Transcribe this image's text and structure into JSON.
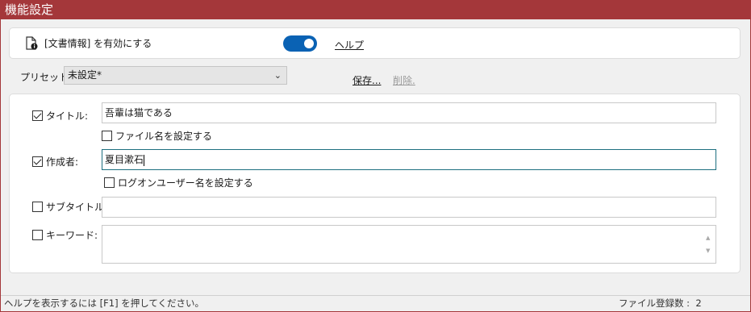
{
  "window": {
    "title": "機能設定"
  },
  "feature": {
    "label": "[文書情報] を有効にする",
    "toggle_on": true,
    "help_label": "ヘルプ",
    "accent_color": "#0a62b4"
  },
  "preset": {
    "label": "プリセット :",
    "selected": "未設定*",
    "save_label": "保存...",
    "delete_label": "削除."
  },
  "fields": {
    "title": {
      "label": "タイトル:",
      "checked": true,
      "value": "吾輩は猫である",
      "sub_checkbox_label": "ファイル名を設定する",
      "sub_checked": false
    },
    "author": {
      "label": "作成者:",
      "checked": true,
      "value": "夏目漱石",
      "sub_checkbox_label": "ログオンユーザー名を設定する",
      "sub_checked": false
    },
    "subtitle": {
      "label": "サブタイトル:",
      "checked": false,
      "value": ""
    },
    "keywords": {
      "label": "キーワード:",
      "checked": false,
      "value": ""
    }
  },
  "status": {
    "help_hint": "ヘルプを表示するには [F1] を押してください。",
    "file_count_label": "ファイル登録数 :",
    "file_count": "2"
  },
  "colors": {
    "titlebar": "#a4373a",
    "focus_border": "#1e6f80"
  }
}
